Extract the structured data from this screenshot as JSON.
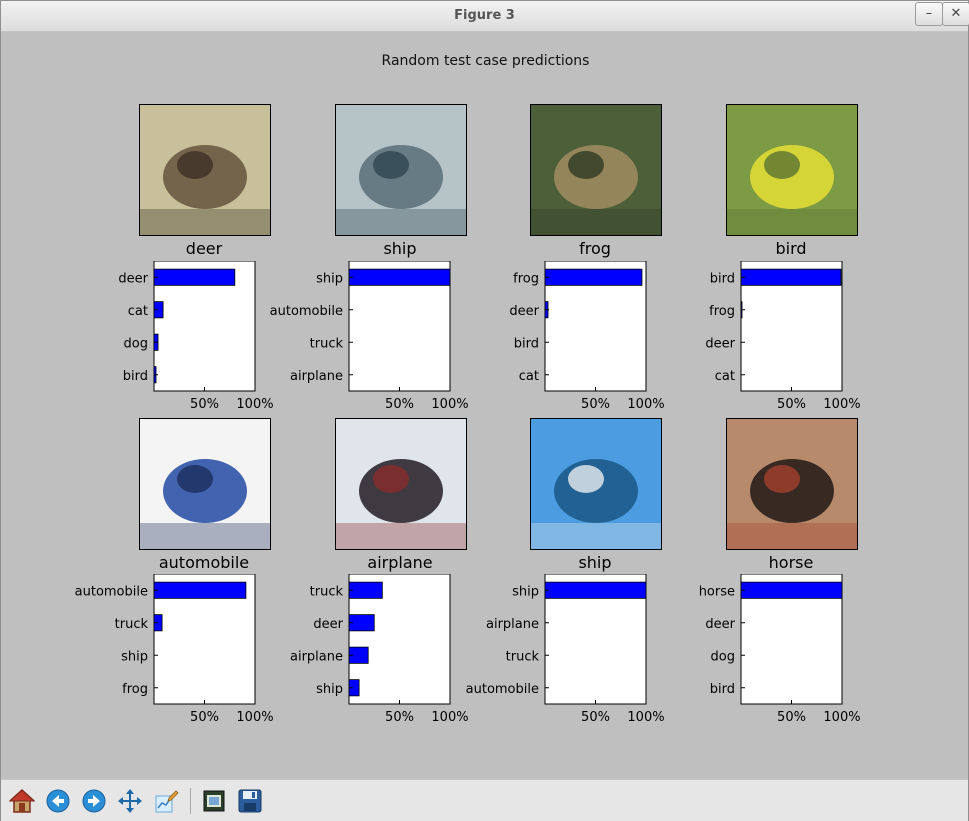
{
  "window": {
    "title": "Figure 3",
    "minimize_symbol": "–",
    "close_symbol": "✕"
  },
  "figure": {
    "suptitle": "Random test case predictions"
  },
  "panels": [
    {
      "label": "deer",
      "image_desc": "deer",
      "image_colors": [
        "#c7c09a",
        "#6b5a44",
        "#3d3024"
      ],
      "chart_data": {
        "type": "bar",
        "categories": [
          "deer",
          "cat",
          "dog",
          "bird"
        ],
        "values": [
          0.8,
          0.09,
          0.04,
          0.02
        ],
        "xlim": [
          0,
          1
        ],
        "ticks": [
          "50%",
          "100%"
        ]
      }
    },
    {
      "label": "ship",
      "image_desc": "ship",
      "image_colors": [
        "#b6c3c7",
        "#5d737c",
        "#2f4650"
      ],
      "chart_data": {
        "type": "bar",
        "categories": [
          "ship",
          "automobile",
          "truck",
          "airplane"
        ],
        "values": [
          1.0,
          0.0,
          0.0,
          0.0
        ],
        "xlim": [
          0,
          1
        ],
        "ticks": [
          "50%",
          "100%"
        ]
      }
    },
    {
      "label": "frog",
      "image_desc": "frog",
      "image_colors": [
        "#4c5f39",
        "#9c8a5e",
        "#2d3a23"
      ],
      "chart_data": {
        "type": "bar",
        "categories": [
          "frog",
          "deer",
          "bird",
          "cat"
        ],
        "values": [
          0.96,
          0.03,
          0.0,
          0.0
        ],
        "xlim": [
          0,
          1
        ],
        "ticks": [
          "50%",
          "100%"
        ]
      }
    },
    {
      "label": "bird",
      "image_desc": "bird",
      "image_colors": [
        "#7d9a45",
        "#dfdb35",
        "#5a7332"
      ],
      "chart_data": {
        "type": "bar",
        "categories": [
          "bird",
          "frog",
          "deer",
          "cat"
        ],
        "values": [
          0.99,
          0.01,
          0.0,
          0.0
        ],
        "xlim": [
          0,
          1
        ],
        "ticks": [
          "50%",
          "100%"
        ]
      }
    },
    {
      "label": "automobile",
      "image_desc": "automobile",
      "image_colors": [
        "#f4f4f4",
        "#2f54a8",
        "#1c2d5c"
      ],
      "chart_data": {
        "type": "bar",
        "categories": [
          "automobile",
          "truck",
          "ship",
          "frog"
        ],
        "values": [
          0.91,
          0.08,
          0.0,
          0.0
        ],
        "xlim": [
          0,
          1
        ],
        "ticks": [
          "50%",
          "100%"
        ]
      }
    },
    {
      "label": "airplane",
      "image_desc": "airplane",
      "image_colors": [
        "#dfe5ea",
        "#2e2630",
        "#8a2c2a"
      ],
      "chart_data": {
        "type": "bar",
        "categories": [
          "truck",
          "deer",
          "airplane",
          "ship"
        ],
        "values": [
          0.33,
          0.25,
          0.19,
          0.1
        ],
        "xlim": [
          0,
          1
        ],
        "ticks": [
          "50%",
          "100%"
        ]
      }
    },
    {
      "label": "ship",
      "image_desc": "ship",
      "image_colors": [
        "#4b9ce0",
        "#1e5b8c",
        "#e8ecef"
      ],
      "chart_data": {
        "type": "bar",
        "categories": [
          "ship",
          "airplane",
          "truck",
          "automobile"
        ],
        "values": [
          1.0,
          0.0,
          0.0,
          0.0
        ],
        "xlim": [
          0,
          1
        ],
        "ticks": [
          "50%",
          "100%"
        ]
      }
    },
    {
      "label": "horse",
      "image_desc": "horse",
      "image_colors": [
        "#b78a6c",
        "#2a1f1b",
        "#a5402e"
      ],
      "chart_data": {
        "type": "bar",
        "categories": [
          "horse",
          "deer",
          "dog",
          "bird"
        ],
        "values": [
          1.0,
          0.0,
          0.0,
          0.0
        ],
        "xlim": [
          0,
          1
        ],
        "ticks": [
          "50%",
          "100%"
        ]
      }
    }
  ],
  "toolbar": {
    "buttons": [
      {
        "name": "home-button",
        "icon": "home-icon"
      },
      {
        "name": "back-button",
        "icon": "back-arrow-icon"
      },
      {
        "name": "forward-button",
        "icon": "forward-arrow-icon"
      },
      {
        "name": "pan-button",
        "icon": "move-arrows-icon"
      },
      {
        "name": "edit-axis-button",
        "icon": "edit-axis-icon"
      },
      {
        "name": "subplots-button",
        "icon": "subplots-icon"
      },
      {
        "name": "save-button",
        "icon": "floppy-disk-icon"
      }
    ]
  },
  "colors": {
    "bar": "#0000ff",
    "background": "#bfbfbf",
    "axes": "#ffffff"
  }
}
